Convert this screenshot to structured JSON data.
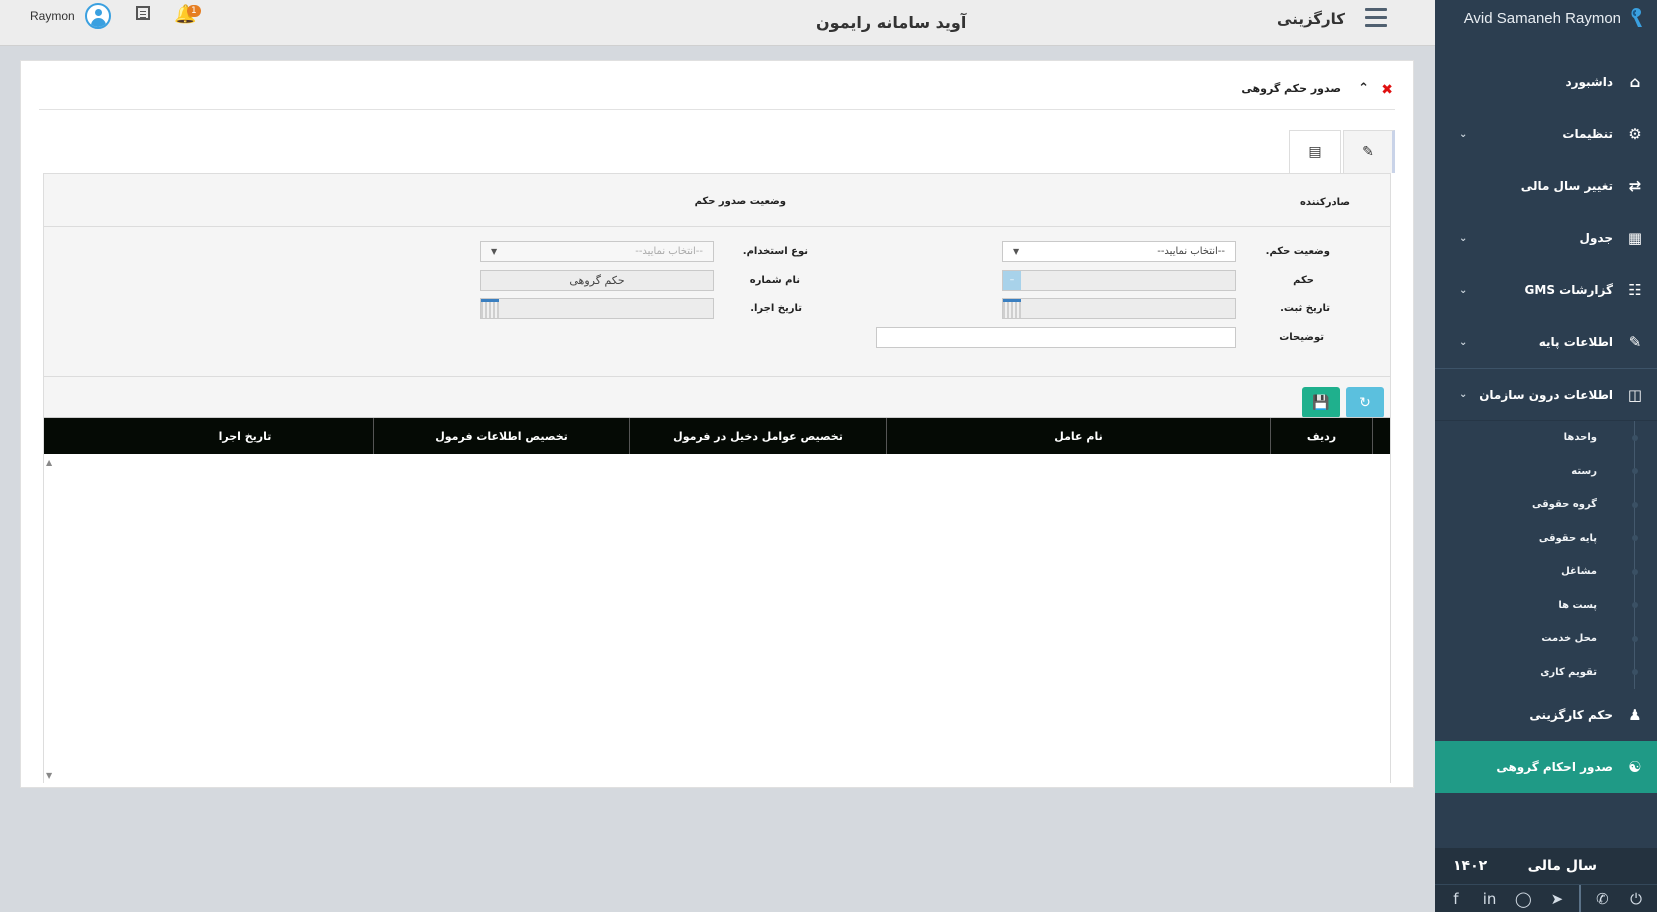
{
  "brand": {
    "name": "Avid Samaneh Raymon"
  },
  "topbar": {
    "section": "کارگزینی",
    "app_title": "آوید سامانه رایمون",
    "user_name": "Raymon",
    "notification_count": "1"
  },
  "sidebar": {
    "items": [
      {
        "label": "داشبورد",
        "icon": "home-icon"
      },
      {
        "label": "تنظیمات",
        "icon": "gears-icon"
      },
      {
        "label": "تغییر سال مالی",
        "icon": "retweet-icon"
      },
      {
        "label": "جدول",
        "icon": "table-icon"
      },
      {
        "label": "گزارشات GMS",
        "icon": "sitemap-icon"
      },
      {
        "label": "اطلاعات پایه",
        "icon": "edit-icon"
      },
      {
        "label": "اطلاعات درون سازمان",
        "icon": "building-icon"
      }
    ],
    "sub_items": [
      "واحدها",
      "رسته",
      "گروه حقوقی",
      "پایه حقوقی",
      "مشاغل",
      "پست ها",
      "محل خدمت",
      "تقویم کاری"
    ],
    "items_after": [
      {
        "label": "حکم کارگزینی",
        "icon": "user-icon"
      },
      {
        "label": "صدور احکام گروهی",
        "icon": "users-icon"
      }
    ],
    "fiscal_year_label": "سال مالی",
    "fiscal_year_value": "۱۴۰۲"
  },
  "panel": {
    "title": "صدور حکم گروهی",
    "strip": {
      "issuer_label": "صادرکننده",
      "status_label": "وضعیت صدور حکم"
    },
    "form": {
      "decree_status_label": "وضعیت حکم.",
      "decree_status_value": "--انتخاب نمایید--",
      "employment_type_label": "نوع استخدام.",
      "employment_type_value": "--انتخاب نمایید--",
      "decree_label": "حکم",
      "letter_number_label": "نام شماره",
      "letter_number_value": "حکم گروهی",
      "record_date_label": "تاریخ ثبت.",
      "exec_date_label": "تاریخ اجرا.",
      "description_label": "توضیحات"
    },
    "grid": {
      "columns": [
        "ردیف",
        "نام عامل",
        "تخصیص عوامل دخیل در فرمول",
        "تخصیص اطلاعات فرمول",
        "تاریخ اجرا"
      ]
    }
  },
  "colors": {
    "sidebar_bg": "#2c3e50",
    "active_item": "#1f9a86",
    "save_button": "#1fb08d",
    "refresh_button": "#5bc0de",
    "grid_header": "#050a05"
  }
}
